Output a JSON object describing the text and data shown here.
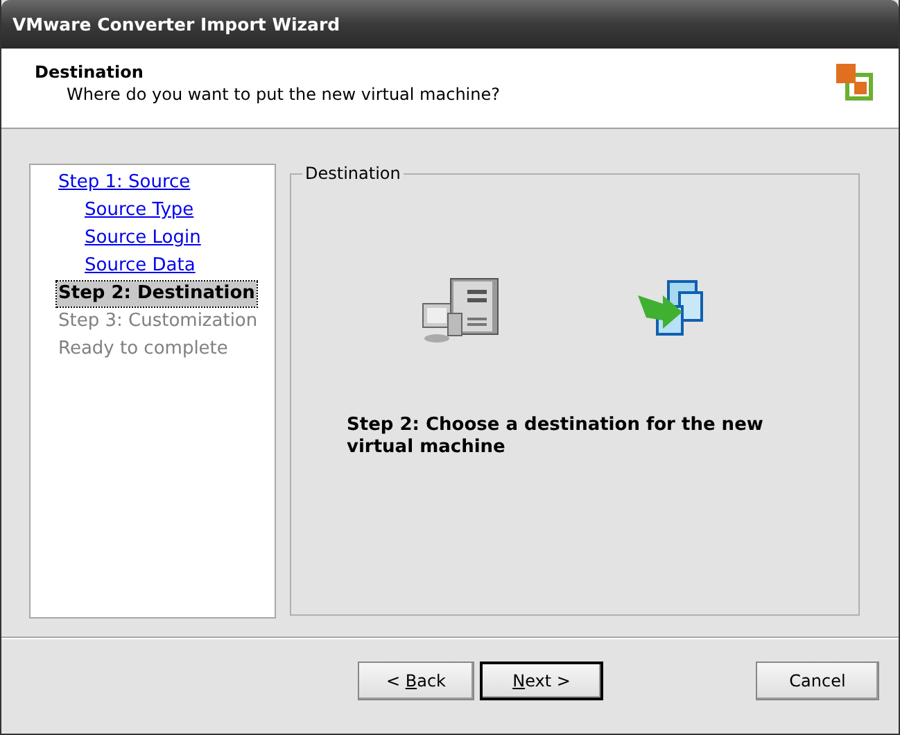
{
  "window": {
    "title": "VMware Converter Import Wizard"
  },
  "header": {
    "title": "Destination",
    "subtitle": "Where do you want to put the new virtual machine?"
  },
  "steps": [
    {
      "label": "Step 1: Source",
      "kind": "link",
      "selected": false,
      "children": [
        {
          "label": "Source Type",
          "kind": "link",
          "selected": false
        },
        {
          "label": "Source Login",
          "kind": "link",
          "selected": false
        },
        {
          "label": "Source Data",
          "kind": "link",
          "selected": false
        }
      ]
    },
    {
      "label": "Step 2: Destination",
      "kind": "current",
      "selected": true
    },
    {
      "label": "Step 3: Customization",
      "kind": "pending",
      "selected": false
    },
    {
      "label": "Ready to complete",
      "kind": "pending",
      "selected": false
    }
  ],
  "panel": {
    "legend": "Destination",
    "message": "Step 2: Choose a destination for the new virtual machine"
  },
  "buttons": [
    {
      "before": "< ",
      "key": "B",
      "after": "ack",
      "kind": "back",
      "default": false
    },
    {
      "key": "N",
      "after": "ext >",
      "kind": "next",
      "default": true
    },
    {
      "after": "Cancel",
      "kind": "cancel",
      "default": false
    }
  ]
}
